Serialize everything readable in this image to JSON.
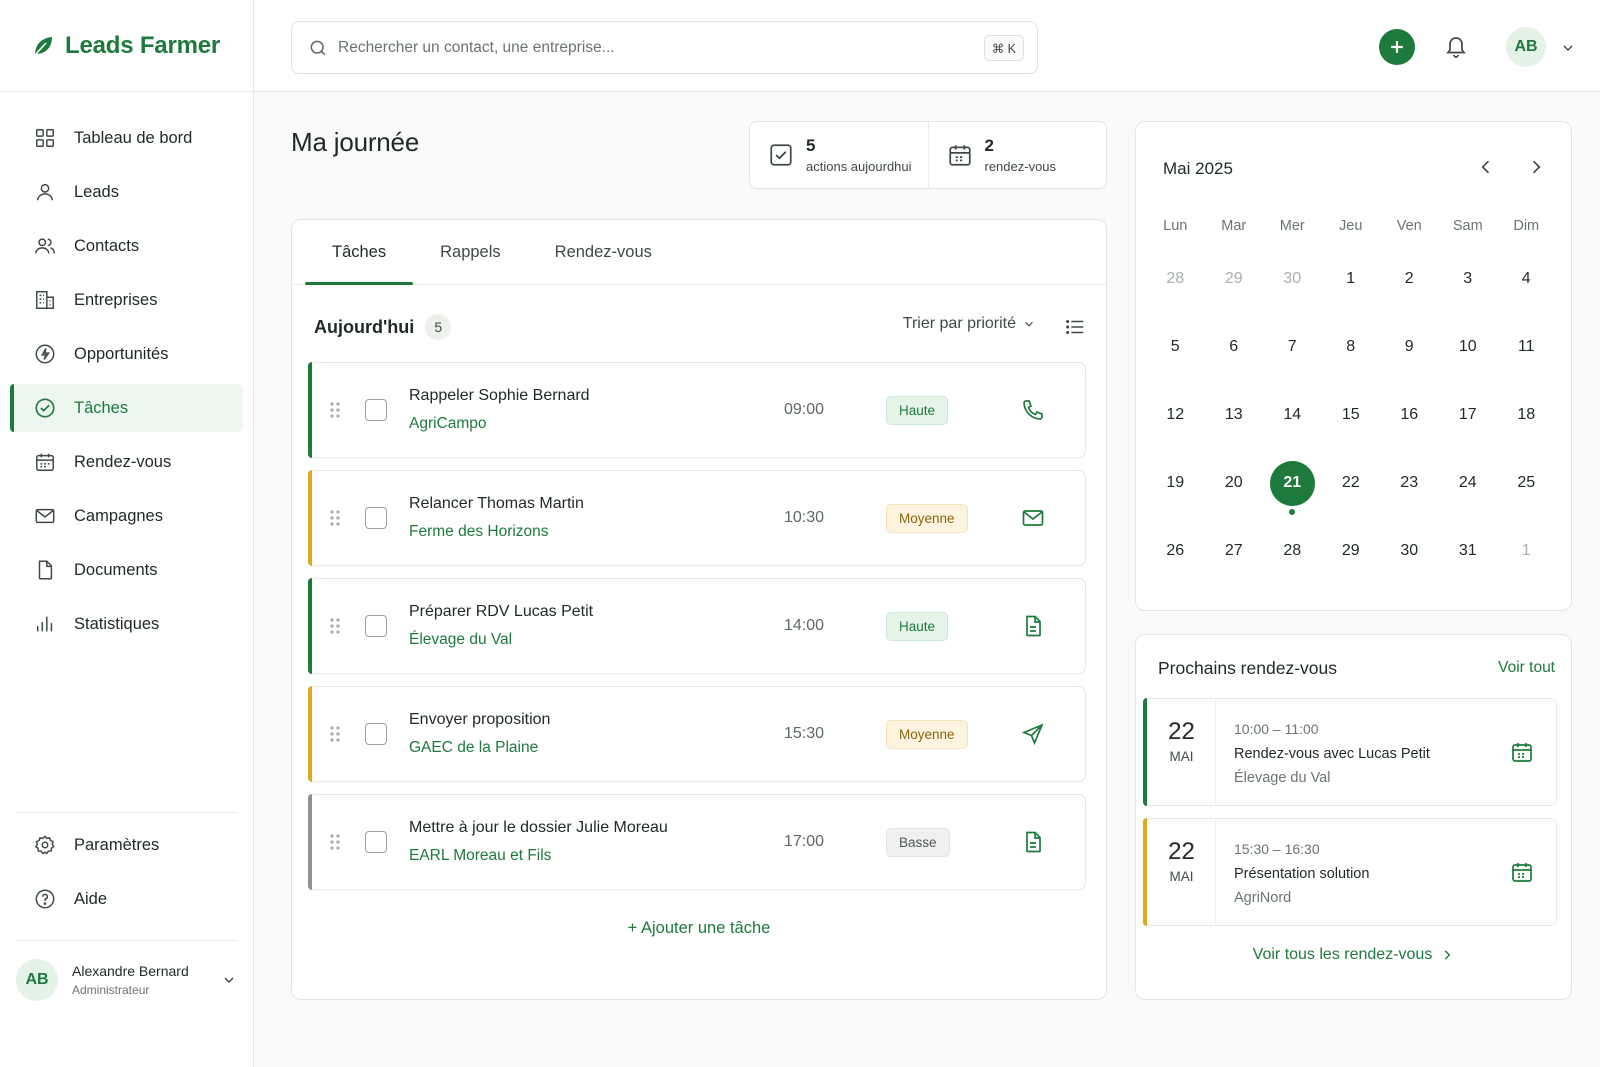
{
  "brand": {
    "name": "Leads Farmer"
  },
  "nav": {
    "items": [
      {
        "label": "Tableau de bord",
        "icon": "grid-icon"
      },
      {
        "label": "Leads",
        "icon": "user-icon"
      },
      {
        "label": "Contacts",
        "icon": "users-icon"
      },
      {
        "label": "Entreprises",
        "icon": "building-icon"
      },
      {
        "label": "Opportunités",
        "icon": "bolt-icon"
      },
      {
        "label": "Tâches",
        "icon": "check-circle-icon",
        "active": true
      },
      {
        "label": "Rendez-vous",
        "icon": "calendar-icon"
      },
      {
        "label": "Campagnes",
        "icon": "mail-icon"
      },
      {
        "label": "Documents",
        "icon": "file-icon"
      },
      {
        "label": "Statistiques",
        "icon": "bar-chart-icon"
      }
    ],
    "bottom": [
      {
        "label": "Paramètres",
        "icon": "gear-icon"
      },
      {
        "label": "Aide",
        "icon": "help-icon"
      }
    ]
  },
  "user": {
    "initials": "AB",
    "name": "Alexandre Bernard",
    "role": "Administrateur"
  },
  "search": {
    "placeholder": "Rechercher un contact, une entreprise...",
    "shortcut": "⌘ K"
  },
  "topbar": {
    "avatar_initials": "AB"
  },
  "page": {
    "title": "Ma journée"
  },
  "stats": [
    {
      "value": "5",
      "label": "actions aujourdhui"
    },
    {
      "value": "2",
      "label": "rendez-vous"
    }
  ],
  "tabs": [
    "Tâches",
    "Rappels",
    "Rendez-vous"
  ],
  "task_list": {
    "title": "Aujourd'hui",
    "count": "5",
    "sort_label": "Trier par priorité",
    "add_label": "+ Ajouter une tâche",
    "tasks": [
      {
        "title": "Rappeler Sophie Bernard",
        "company": "AgriCampo",
        "time": "09:00",
        "priority": "Haute",
        "level": "haute",
        "action_icon": "phone-icon"
      },
      {
        "title": "Relancer Thomas Martin",
        "company": "Ferme des Horizons",
        "time": "10:30",
        "priority": "Moyenne",
        "level": "moyenne",
        "action_icon": "mail-icon"
      },
      {
        "title": "Préparer RDV Lucas Petit",
        "company": "Élevage du Val",
        "time": "14:00",
        "priority": "Haute",
        "level": "haute",
        "action_icon": "file-icon"
      },
      {
        "title": "Envoyer proposition",
        "company": "GAEC de la Plaine",
        "time": "15:30",
        "priority": "Moyenne",
        "level": "moyenne",
        "action_icon": "send-icon"
      },
      {
        "title": "Mettre à jour le dossier Julie Moreau",
        "company": "EARL Moreau et Fils",
        "time": "17:00",
        "priority": "Basse",
        "level": "basse",
        "action_icon": "file-icon"
      }
    ]
  },
  "calendar": {
    "month": "Mai 2025",
    "weekdays": [
      "Lun",
      "Mar",
      "Mer",
      "Jeu",
      "Ven",
      "Sam",
      "Dim"
    ],
    "weeks": [
      [
        "28",
        "29",
        "30",
        "1",
        "2",
        "3",
        "4"
      ],
      [
        "5",
        "6",
        "7",
        "8",
        "9",
        "10",
        "11"
      ],
      [
        "12",
        "13",
        "14",
        "15",
        "16",
        "17",
        "18"
      ],
      [
        "19",
        "20",
        "21",
        "22",
        "23",
        "24",
        "25"
      ],
      [
        "26",
        "27",
        "28",
        "29",
        "30",
        "31",
        "1"
      ]
    ],
    "today": "21"
  },
  "upcoming": {
    "title": "Prochains rendez-vous",
    "see_all": "Voir tout",
    "link": "Voir tous les rendez-vous",
    "items": [
      {
        "day": "22",
        "month": "MAI",
        "hours": "10:00 – 11:00",
        "name": "Rendez-vous avec Lucas Petit",
        "company": "Élevage du Val"
      },
      {
        "day": "22",
        "month": "MAI",
        "hours": "15:30 – 16:30",
        "name": "Présentation solution",
        "company": "AgriNord"
      }
    ]
  },
  "colors": {
    "accent": "#1e7a3c",
    "medium": "#e0a81e",
    "low": "#8d9591"
  }
}
